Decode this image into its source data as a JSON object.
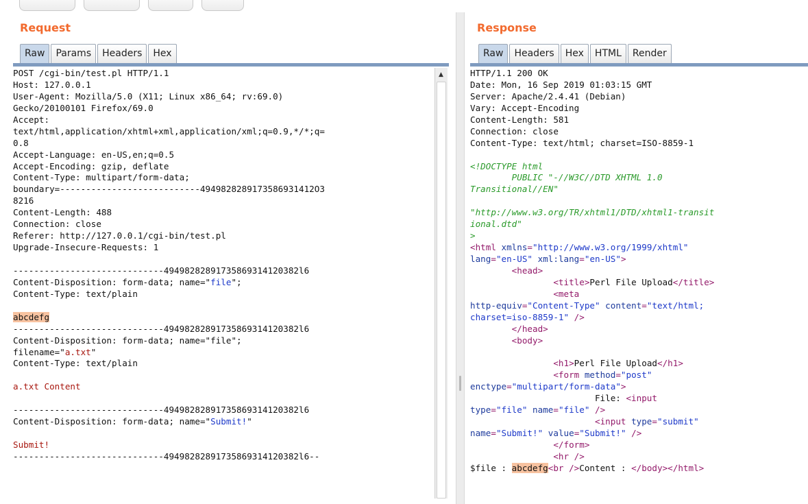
{
  "request": {
    "title": "Request",
    "tabs": [
      "Raw",
      "Params",
      "Headers",
      "Hex"
    ],
    "active_tab": "Raw",
    "lines": [
      [
        {
          "t": "POST /cgi-bin/test.pl HTTP/1.1"
        }
      ],
      [
        {
          "t": "Host: 127.0.0.1"
        }
      ],
      [
        {
          "t": "User-Agent: Mozilla/5.0 (X11; Linux x86_64; rv:69.0)"
        }
      ],
      [
        {
          "t": "Gecko/20100101 Firefox/69.0"
        }
      ],
      [
        {
          "t": "Accept:"
        }
      ],
      [
        {
          "t": "text/html,application/xhtml+xml,application/xml;q=0.9,*/*;q="
        }
      ],
      [
        {
          "t": "0.8"
        }
      ],
      [
        {
          "t": "Accept-Language: en-US,en;q=0.5"
        }
      ],
      [
        {
          "t": "Accept-Encoding: gzip, deflate"
        }
      ],
      [
        {
          "t": "Content-Type: multipart/form-data;"
        }
      ],
      [
        {
          "t": "boundary=---------------------------4949828289173586931412O3"
        }
      ],
      [
        {
          "t": "8216"
        }
      ],
      [
        {
          "t": "Content-Length: 488"
        }
      ],
      [
        {
          "t": "Connection: close"
        }
      ],
      [
        {
          "t": "Referer: http://127.0.0.1/cgi-bin/test.pl"
        }
      ],
      [
        {
          "t": "Upgrade-Insecure-Requests: 1"
        }
      ],
      [
        {
          "t": ""
        }
      ],
      [
        {
          "t": "-----------------------------49498282891735869314120382l6"
        }
      ],
      [
        {
          "t": "Content-Disposition: form-data; name=\""
        },
        {
          "t": "file",
          "c": "str"
        },
        {
          "t": "\";"
        }
      ],
      [
        {
          "t": "Content-Type: text/plain"
        }
      ],
      [
        {
          "t": ""
        }
      ],
      [
        {
          "t": "abcdefg",
          "c": "hl"
        }
      ],
      [
        {
          "t": "-----------------------------49498282891735869314120382l6"
        }
      ],
      [
        {
          "t": "Content-Disposition: form-data; name=\"file\";"
        }
      ],
      [
        {
          "t": "filename=\""
        },
        {
          "t": "a.txt",
          "c": "red"
        },
        {
          "t": "\""
        }
      ],
      [
        {
          "t": "Content-Type: text/plain"
        }
      ],
      [
        {
          "t": ""
        }
      ],
      [
        {
          "t": "a.txt Content",
          "c": "red"
        }
      ],
      [
        {
          "t": ""
        }
      ],
      [
        {
          "t": "-----------------------------49498282891735869314120382l6"
        }
      ],
      [
        {
          "t": "Content-Disposition: form-data; name=\""
        },
        {
          "t": "Submit!",
          "c": "str"
        },
        {
          "t": "\""
        }
      ],
      [
        {
          "t": ""
        }
      ],
      [
        {
          "t": "Submit!",
          "c": "red"
        }
      ],
      [
        {
          "t": "-----------------------------49498282891735869314120382l6--"
        }
      ]
    ]
  },
  "response": {
    "title": "Response",
    "tabs": [
      "Raw",
      "Headers",
      "Hex",
      "HTML",
      "Render"
    ],
    "active_tab": "Raw",
    "lines": [
      [
        {
          "t": "HTTP/1.1 200 OK"
        }
      ],
      [
        {
          "t": "Date: Mon, 16 Sep 2019 01:03:15 GMT"
        }
      ],
      [
        {
          "t": "Server: Apache/2.4.41 (Debian)"
        }
      ],
      [
        {
          "t": "Vary: Accept-Encoding"
        }
      ],
      [
        {
          "t": "Content-Length: 581"
        }
      ],
      [
        {
          "t": "Connection: close"
        }
      ],
      [
        {
          "t": "Content-Type: text/html; charset=ISO-8859-1"
        }
      ],
      [
        {
          "t": ""
        }
      ],
      [
        {
          "t": "<!DOCTYPE html",
          "c": "com"
        }
      ],
      [
        {
          "t": "        PUBLIC \"-//W3C//DTD XHTML 1.0",
          "c": "com"
        }
      ],
      [
        {
          "t": "Transitional//EN\"",
          "c": "com"
        }
      ],
      [
        {
          "t": ""
        }
      ],
      [
        {
          "t": "\"http://www.w3.org/TR/xhtml1/DTD/xhtml1-transit",
          "c": "com"
        }
      ],
      [
        {
          "t": "ional.dtd\"",
          "c": "com"
        }
      ],
      [
        {
          "t": ">",
          "c": "com"
        }
      ],
      [
        {
          "t": "<html ",
          "c": "tag"
        },
        {
          "t": "xmlns",
          "c": "attr"
        },
        {
          "t": "=",
          "c": "tag"
        },
        {
          "t": "\"http://www.w3.org/1999/xhtml\"",
          "c": "str"
        }
      ],
      [
        {
          "t": "lang",
          "c": "attr"
        },
        {
          "t": "=",
          "c": "tag"
        },
        {
          "t": "\"en-US\"",
          "c": "str"
        },
        {
          "t": " "
        },
        {
          "t": "xml:lang",
          "c": "attr"
        },
        {
          "t": "=",
          "c": "tag"
        },
        {
          "t": "\"en-US\"",
          "c": "str"
        },
        {
          "t": ">",
          "c": "tag"
        }
      ],
      [
        {
          "t": "        "
        },
        {
          "t": "<head>",
          "c": "tag"
        }
      ],
      [
        {
          "t": "                "
        },
        {
          "t": "<title>",
          "c": "tag"
        },
        {
          "t": "Perl File Upload"
        },
        {
          "t": "</title>",
          "c": "tag"
        }
      ],
      [
        {
          "t": "                "
        },
        {
          "t": "<meta",
          "c": "tag"
        }
      ],
      [
        {
          "t": "http-equiv",
          "c": "attr"
        },
        {
          "t": "=",
          "c": "tag"
        },
        {
          "t": "\"Content-Type\"",
          "c": "str"
        },
        {
          "t": " "
        },
        {
          "t": "content",
          "c": "attr"
        },
        {
          "t": "=",
          "c": "tag"
        },
        {
          "t": "\"text/html;",
          "c": "str"
        }
      ],
      [
        {
          "t": "charset=iso-8859-1\"",
          "c": "str"
        },
        {
          "t": " />",
          "c": "tag"
        }
      ],
      [
        {
          "t": "        "
        },
        {
          "t": "</head>",
          "c": "tag"
        }
      ],
      [
        {
          "t": "        "
        },
        {
          "t": "<body>",
          "c": "tag"
        }
      ],
      [
        {
          "t": ""
        }
      ],
      [
        {
          "t": "                "
        },
        {
          "t": "<h1>",
          "c": "tag"
        },
        {
          "t": "Perl File Upload"
        },
        {
          "t": "</h1>",
          "c": "tag"
        }
      ],
      [
        {
          "t": "                "
        },
        {
          "t": "<form ",
          "c": "tag"
        },
        {
          "t": "method",
          "c": "attr"
        },
        {
          "t": "=",
          "c": "tag"
        },
        {
          "t": "\"post\"",
          "c": "str"
        }
      ],
      [
        {
          "t": "enctype",
          "c": "attr"
        },
        {
          "t": "=",
          "c": "tag"
        },
        {
          "t": "\"multipart/form-data\"",
          "c": "str"
        },
        {
          "t": ">",
          "c": "tag"
        }
      ],
      [
        {
          "t": "                        File: "
        },
        {
          "t": "<input",
          "c": "tag"
        }
      ],
      [
        {
          "t": "type",
          "c": "attr"
        },
        {
          "t": "=",
          "c": "tag"
        },
        {
          "t": "\"file\"",
          "c": "str"
        },
        {
          "t": " "
        },
        {
          "t": "name",
          "c": "attr"
        },
        {
          "t": "=",
          "c": "tag"
        },
        {
          "t": "\"file\"",
          "c": "str"
        },
        {
          "t": " />",
          "c": "tag"
        }
      ],
      [
        {
          "t": "                        "
        },
        {
          "t": "<input ",
          "c": "tag"
        },
        {
          "t": "type",
          "c": "attr"
        },
        {
          "t": "=",
          "c": "tag"
        },
        {
          "t": "\"submit\"",
          "c": "str"
        }
      ],
      [
        {
          "t": "name",
          "c": "attr"
        },
        {
          "t": "=",
          "c": "tag"
        },
        {
          "t": "\"Submit!\"",
          "c": "str"
        },
        {
          "t": " "
        },
        {
          "t": "value",
          "c": "attr"
        },
        {
          "t": "=",
          "c": "tag"
        },
        {
          "t": "\"Submit!\"",
          "c": "str"
        },
        {
          "t": " />",
          "c": "tag"
        }
      ],
      [
        {
          "t": "                "
        },
        {
          "t": "</form>",
          "c": "tag"
        }
      ],
      [
        {
          "t": "                "
        },
        {
          "t": "<hr />",
          "c": "tag"
        }
      ],
      [
        {
          "t": "$file : "
        },
        {
          "t": "abcdefg",
          "c": "hl"
        },
        {
          "t": "<br />",
          "c": "tag"
        },
        {
          "t": "Content : "
        },
        {
          "t": "</body></html>",
          "c": "tag"
        }
      ]
    ]
  },
  "icons": {
    "scroll_up": "scroll-up-arrow-icon",
    "splitter": "splitter-grip-icon"
  }
}
